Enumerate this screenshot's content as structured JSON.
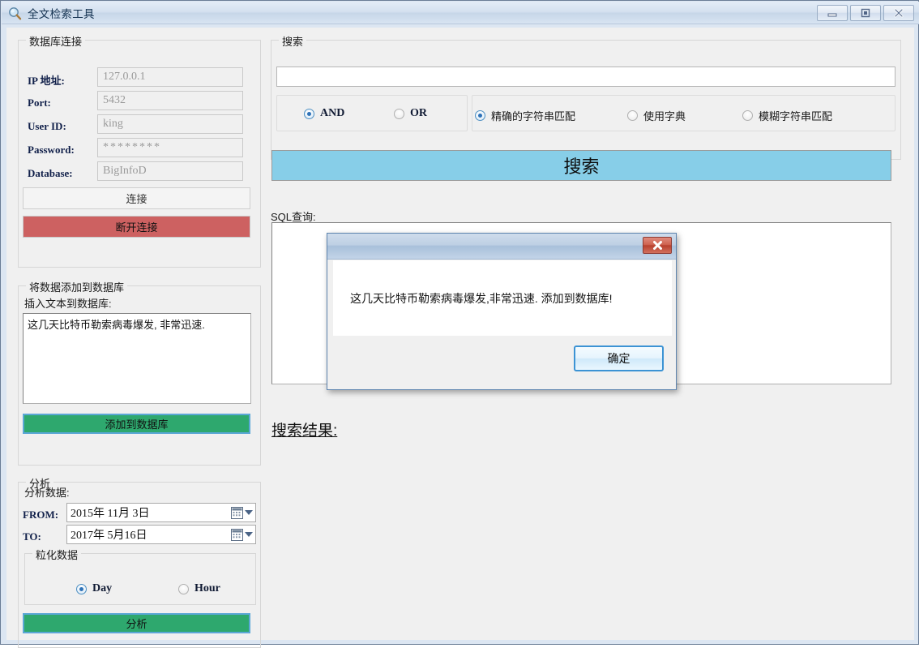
{
  "window": {
    "title": "全文检索工具",
    "icon": "magnifier-icon",
    "buttons": {
      "minimize": "minimize-icon",
      "maximize": "restore-icon",
      "close": "close-icon"
    }
  },
  "db_connection": {
    "group_title": "数据库连接",
    "fields": [
      {
        "label": "IP 地址:",
        "value": "127.0.0.1"
      },
      {
        "label": "Port:",
        "value": "5432"
      },
      {
        "label": "User ID:",
        "value": "king"
      },
      {
        "label": "Password:",
        "value": "********"
      },
      {
        "label": "Database:",
        "value": "BigInfoD"
      }
    ],
    "connect_label": "连接",
    "disconnect_label": "断开连接",
    "disconnect_color": "#cd6161"
  },
  "add_data": {
    "group_title": "将数据添加到数据库",
    "textarea_label": "插入文本到数据库:",
    "textarea_value": "这几天比特币勒索病毒爆发, 非常迅速.",
    "add_button_label": "添加到数据库",
    "add_button_color": "#2ea86e"
  },
  "analysis": {
    "group_title": "分析",
    "subtitle": "分析数据:",
    "from_label": "FROM:",
    "from_value": "2015年 11月  3日",
    "to_label": "TO:",
    "to_value": "2017年  5月16日",
    "granularity": {
      "group_title": "粒化数据",
      "options": [
        {
          "label": "Day",
          "selected": true
        },
        {
          "label": "Hour",
          "selected": false
        }
      ]
    },
    "analyze_button_label": "分析",
    "analyze_button_color": "#2ea86e",
    "calendar_icon": "calendar-icon",
    "dropdown_icon": "chevron-down-icon"
  },
  "search": {
    "group_title": "搜索",
    "query_value": "",
    "query_placeholder": "",
    "logic_options": [
      {
        "label": "AND",
        "selected": true
      },
      {
        "label": "OR",
        "selected": false
      }
    ],
    "match_options": [
      {
        "label": "精确的字符串匹配",
        "selected": true
      },
      {
        "label": "使用字典",
        "selected": false
      },
      {
        "label": "模糊字符串匹配",
        "selected": false
      }
    ],
    "search_button_label": "搜索",
    "search_button_color": "#87cee8",
    "sql_label": "SQL查询:",
    "sql_value": "",
    "results_label": "搜索结果:"
  },
  "dialog": {
    "message": "这几天比特币勒索病毒爆发,非常迅速. 添加到数据库!",
    "ok_label": "确定",
    "close_icon": "close-icon"
  }
}
